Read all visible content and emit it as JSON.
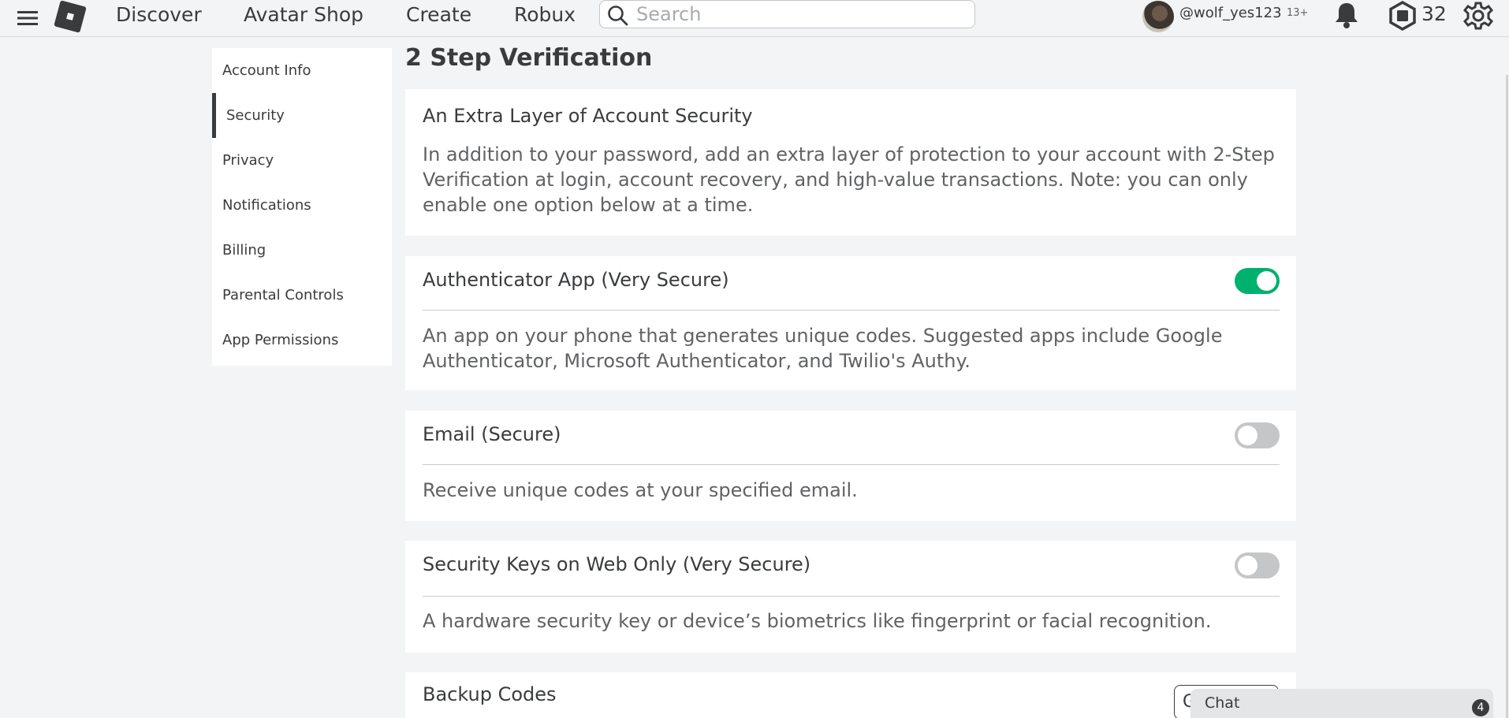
{
  "topbar": {
    "nav": [
      "Discover",
      "Avatar Shop",
      "Create",
      "Robux"
    ],
    "search_placeholder": "Search",
    "username": "@wolf_yes123",
    "age_label": "13+",
    "robux_count": "32",
    "icons": [
      "menu-icon",
      "roblox-logo",
      "search-icon",
      "bell-icon",
      "robux-icon",
      "gear-icon"
    ]
  },
  "sidebar": {
    "items": [
      {
        "label": "Account Info",
        "active": false
      },
      {
        "label": "Security",
        "active": true
      },
      {
        "label": "Privacy",
        "active": false
      },
      {
        "label": "Notifications",
        "active": false
      },
      {
        "label": "Billing",
        "active": false
      },
      {
        "label": "Parental Controls",
        "active": false
      },
      {
        "label": "App Permissions",
        "active": false
      }
    ]
  },
  "main": {
    "title": "2 Step Verification",
    "intro": {
      "heading": "An Extra Layer of Account Security",
      "text": "In addition to your password, add an extra layer of protection to your account with 2-Step Verification at login, account recovery, and high-value transactions. Note: you can only enable one option below at a time."
    },
    "options": [
      {
        "heading": "Authenticator App (Very Secure)",
        "text": "An app on your phone that generates unique codes. Suggested apps include Google Authenticator, Microsoft Authenticator, and Twilio's Authy.",
        "enabled": true
      },
      {
        "heading": "Email (Secure)",
        "text": "Receive unique codes at your specified email.",
        "enabled": false
      },
      {
        "heading": "Security Keys on Web Only (Very Secure)",
        "text": "A hardware security key or device’s biometrics like fingerprint or facial recognition.",
        "enabled": false
      }
    ],
    "backup": {
      "heading": "Backup Codes",
      "button_label": "G"
    }
  },
  "chat": {
    "label": "Chat",
    "badge": "4"
  },
  "colors": {
    "toggle_on": "#00b06f",
    "toggle_off": "#c4c6c8",
    "text": "#393b3d",
    "background": "#f2f4f5"
  }
}
